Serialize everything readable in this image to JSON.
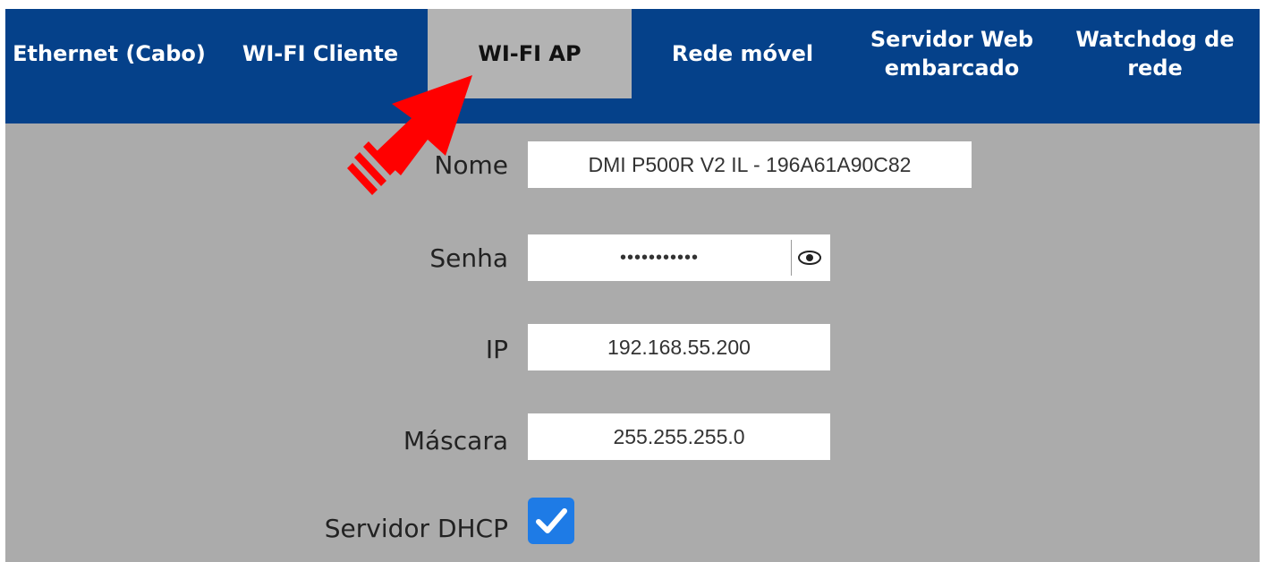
{
  "tabs": [
    {
      "label": "Ethernet (Cabo)"
    },
    {
      "label": "WI-FI Cliente"
    },
    {
      "label": "WI-FI AP"
    },
    {
      "label": "Rede móvel"
    },
    {
      "label": "Servidor Web\nembarcado"
    },
    {
      "label": "Watchdog de\nrede"
    }
  ],
  "active_tab": "WI-FI AP",
  "form": {
    "name_label": "Nome",
    "name_value": "DMI P500R V2 IL - 196A61A90C82",
    "password_label": "Senha",
    "password_value": "•••••••••••",
    "ip_label": "IP",
    "ip_value": "192.168.55.200",
    "mask_label": "Máscara",
    "mask_value": "255.255.255.0",
    "dhcp_label": "Servidor DHCP",
    "dhcp_checked": true
  },
  "colors": {
    "tabbar": "#05418a",
    "active_tab": "#b3b3b3",
    "panel": "#ababab",
    "checkbox": "#1e7be6",
    "arrow": "#ff0000"
  },
  "icons": {
    "show_password": "eye-icon",
    "checkmark": "checkmark-icon",
    "annotation": "red-arrow-icon"
  }
}
